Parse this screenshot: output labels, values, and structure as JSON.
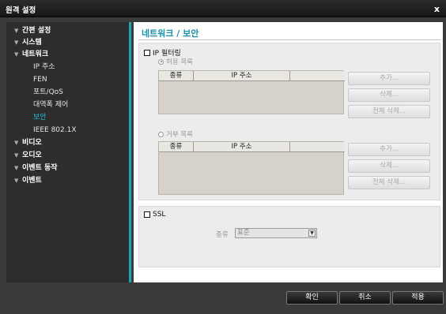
{
  "window": {
    "title": "원격 설정",
    "close_glyph": "x"
  },
  "sidebar": {
    "items": [
      {
        "label": "간편 설정",
        "level": 0
      },
      {
        "label": "시스템",
        "level": 0
      },
      {
        "label": "네트워크",
        "level": 0
      },
      {
        "label": "IP 주소",
        "level": 1
      },
      {
        "label": "FEN",
        "level": 1
      },
      {
        "label": "포트/QoS",
        "level": 1
      },
      {
        "label": "대역폭 제어",
        "level": 1
      },
      {
        "label": "보안",
        "level": 1,
        "active": true
      },
      {
        "label": "IEEE 802.1X",
        "level": 1
      },
      {
        "label": "비디오",
        "level": 0
      },
      {
        "label": "오디오",
        "level": 0
      },
      {
        "label": "이벤트 동작",
        "level": 0
      },
      {
        "label": "이벤트",
        "level": 0
      }
    ],
    "arrow_glyph": "▼"
  },
  "main": {
    "title": "네트워크 / 보안",
    "ip_filtering": {
      "label": "IP 필터링",
      "allow": {
        "label": "허용 목록",
        "columns": [
          "종류",
          "IP 주소"
        ],
        "buttons": [
          "추가...",
          "삭제...",
          "전체 삭제..."
        ]
      },
      "deny": {
        "label": "거부 목록",
        "columns": [
          "종류",
          "IP 주소"
        ],
        "buttons": [
          "추가...",
          "삭제...",
          "전체 삭제..."
        ]
      }
    },
    "ssl": {
      "label": "SSL",
      "type_label": "종류",
      "type_value": "표준"
    }
  },
  "footer": {
    "ok": "확인",
    "cancel": "취소",
    "apply": "적용"
  },
  "colors": {
    "accent": "#1591a8",
    "active_item": "#22c0d6",
    "sidebar_border": "#21a3b4"
  }
}
